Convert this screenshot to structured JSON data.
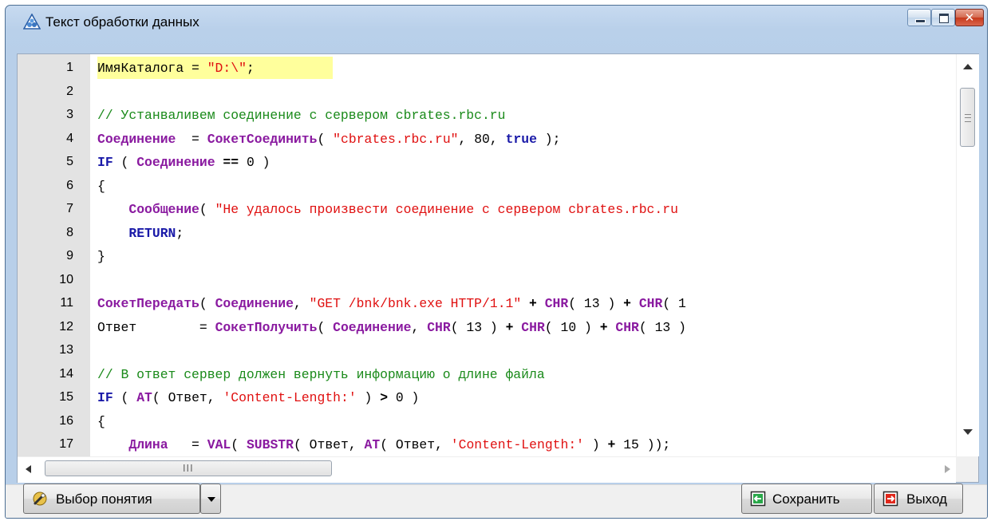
{
  "window": {
    "title": "Текст обработки данных",
    "close_glyph": "✕"
  },
  "editor": {
    "line_numbers": [
      "1",
      "2",
      "3",
      "4",
      "5",
      "6",
      "7",
      "8",
      "9",
      "10",
      "11",
      "12",
      "13",
      "14",
      "15",
      "16",
      "17"
    ],
    "lines": [
      [
        [
          "id",
          "ИмяКаталога = "
        ],
        [
          "str",
          "\"D:\\\""
        ],
        [
          "pun",
          ";"
        ]
      ],
      [],
      [
        [
          "cm",
          "// Устанваливем соединение с сервером cbrates.rbc.ru"
        ]
      ],
      [
        [
          "var",
          "Соединение"
        ],
        [
          "id",
          "  = "
        ],
        [
          "fn",
          "СокетСоединить"
        ],
        [
          "pun",
          "( "
        ],
        [
          "str",
          "\"cbrates.rbc.ru\""
        ],
        [
          "pun",
          ", "
        ],
        [
          "num",
          "80"
        ],
        [
          "pun",
          ", "
        ],
        [
          "kw",
          "true"
        ],
        [
          "pun",
          " );"
        ]
      ],
      [
        [
          "kw",
          "IF"
        ],
        [
          "pun",
          " ( "
        ],
        [
          "var",
          "Соединение"
        ],
        [
          "op",
          " == "
        ],
        [
          "num",
          "0"
        ],
        [
          "pun",
          " )"
        ]
      ],
      [
        [
          "pun",
          "{"
        ]
      ],
      [
        [
          "id",
          "    "
        ],
        [
          "fn",
          "Сообщение"
        ],
        [
          "pun",
          "( "
        ],
        [
          "str",
          "\"Не удалось произвести соединение с сервером cbrates.rbc.ru"
        ]
      ],
      [
        [
          "id",
          "    "
        ],
        [
          "kw",
          "RETURN"
        ],
        [
          "pun",
          ";"
        ]
      ],
      [
        [
          "pun",
          "}"
        ]
      ],
      [],
      [
        [
          "fn",
          "СокетПередать"
        ],
        [
          "pun",
          "( "
        ],
        [
          "var",
          "Соединение"
        ],
        [
          "pun",
          ", "
        ],
        [
          "str",
          "\"GET /bnk/bnk.exe HTTP/1.1\""
        ],
        [
          "op",
          " + "
        ],
        [
          "fn",
          "CHR"
        ],
        [
          "pun",
          "( "
        ],
        [
          "num",
          "13"
        ],
        [
          "pun",
          " ) "
        ],
        [
          "op",
          "+ "
        ],
        [
          "fn",
          "CHR"
        ],
        [
          "pun",
          "( "
        ],
        [
          "num",
          "1"
        ]
      ],
      [
        [
          "id",
          "Ответ        "
        ],
        [
          "id",
          "= "
        ],
        [
          "fn",
          "СокетПолучить"
        ],
        [
          "pun",
          "( "
        ],
        [
          "var",
          "Соединение"
        ],
        [
          "pun",
          ", "
        ],
        [
          "fn",
          "CHR"
        ],
        [
          "pun",
          "( "
        ],
        [
          "num",
          "13"
        ],
        [
          "pun",
          " ) "
        ],
        [
          "op",
          "+ "
        ],
        [
          "fn",
          "CHR"
        ],
        [
          "pun",
          "( "
        ],
        [
          "num",
          "10"
        ],
        [
          "pun",
          " ) "
        ],
        [
          "op",
          "+ "
        ],
        [
          "fn",
          "CHR"
        ],
        [
          "pun",
          "( "
        ],
        [
          "num",
          "13"
        ],
        [
          "pun",
          " )"
        ]
      ],
      [],
      [
        [
          "cm",
          "// В ответ сервер должен вернуть информацию о длине файла"
        ]
      ],
      [
        [
          "kw",
          "IF"
        ],
        [
          "pun",
          " ( "
        ],
        [
          "fn",
          "AT"
        ],
        [
          "pun",
          "( "
        ],
        [
          "id",
          "Ответ"
        ],
        [
          "pun",
          ", "
        ],
        [
          "str",
          "'Content-Length:'"
        ],
        [
          "pun",
          " ) "
        ],
        [
          "op",
          "> "
        ],
        [
          "num",
          "0"
        ],
        [
          "pun",
          " )"
        ]
      ],
      [
        [
          "pun",
          "{"
        ]
      ],
      [
        [
          "id",
          "    "
        ],
        [
          "var",
          "Длина"
        ],
        [
          "id",
          "   = "
        ],
        [
          "fn",
          "VAL"
        ],
        [
          "pun",
          "( "
        ],
        [
          "fn",
          "SUBSTR"
        ],
        [
          "pun",
          "( "
        ],
        [
          "id",
          "Ответ"
        ],
        [
          "pun",
          ", "
        ],
        [
          "fn",
          "AT"
        ],
        [
          "pun",
          "( "
        ],
        [
          "id",
          "Ответ"
        ],
        [
          "pun",
          ", "
        ],
        [
          "str",
          "'Content-Length:'"
        ],
        [
          "pun",
          " ) "
        ],
        [
          "op",
          "+ "
        ],
        [
          "num",
          "15"
        ],
        [
          "pun",
          " ));"
        ]
      ]
    ]
  },
  "scrollbar": {
    "h_grip": "III"
  },
  "buttons": {
    "choose_label": "Выбор понятия",
    "save_label": "Сохранить",
    "exit_label": "Выход"
  }
}
